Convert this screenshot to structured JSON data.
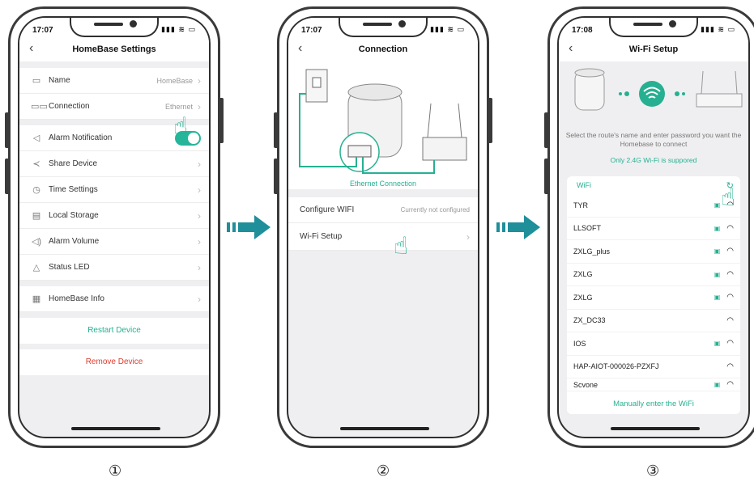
{
  "phone1": {
    "time": "17:07",
    "status_icons": "▮▮▮ ≋ ▭",
    "back": "‹",
    "title": "HomeBase Settings",
    "rows": [
      {
        "icon": "▭",
        "label": "Name",
        "value": "HomeBase",
        "chev": "›"
      },
      {
        "icon": "▭▭",
        "label": "Connection",
        "value": "Ethernet",
        "chev": "›"
      },
      {
        "icon": "◁",
        "label": "Alarm Notification"
      },
      {
        "icon": "≺",
        "label": "Share Device",
        "chev": "›"
      },
      {
        "icon": "◷",
        "label": "Time Settings",
        "chev": "›"
      },
      {
        "icon": "▤",
        "label": "Local Storage",
        "chev": "›"
      },
      {
        "icon": "◁)",
        "label": "Alarm Volume",
        "chev": "›"
      },
      {
        "icon": "△",
        "label": "Status LED",
        "chev": "›"
      },
      {
        "icon": "▦",
        "label": "HomeBase Info",
        "chev": "›"
      }
    ],
    "restart": "Restart Device",
    "remove": "Remove Device"
  },
  "phone2": {
    "time": "17:07",
    "status_icons": "▮▮▮ ≋ ▭",
    "back": "‹",
    "title": "Connection",
    "illustration_caption": "Ethernet Connection",
    "configure_label": "Configure WIFI",
    "configure_value": "Currently not configured",
    "wifi_setup_label": "Wi-Fi Setup",
    "chev": "›"
  },
  "phone3": {
    "time": "17:08",
    "status_icons": "▮▮▮ ≋ ▭",
    "back": "‹",
    "title": "Wi-Fi Setup",
    "instruction": "Select the route's name and enter password you want the Homebase to connect",
    "note": "Only 2.4G Wi-Fi is suppored",
    "wifi_header": "WiFi",
    "networks": [
      {
        "name": "TYR",
        "locked": true
      },
      {
        "name": "LLSOFT",
        "locked": true
      },
      {
        "name": "ZXLG_plus",
        "locked": true
      },
      {
        "name": "ZXLG",
        "locked": true
      },
      {
        "name": "ZXLG",
        "locked": true
      },
      {
        "name": "ZX_DC33",
        "locked": false
      },
      {
        "name": "IOS",
        "locked": true
      },
      {
        "name": "HAP-AIOT-000026-PZXFJ",
        "locked": false
      },
      {
        "name": "Scvone",
        "locked": true
      }
    ],
    "manual": "Manually enter the WiFi"
  },
  "steps": [
    "①",
    "②",
    "③"
  ],
  "colors": {
    "accent": "#26b091",
    "danger": "#e03a2f",
    "arrow": "#1f8f9a"
  },
  "icons": {
    "lock": "🔒",
    "wifi": "📶",
    "hand": "☝"
  }
}
